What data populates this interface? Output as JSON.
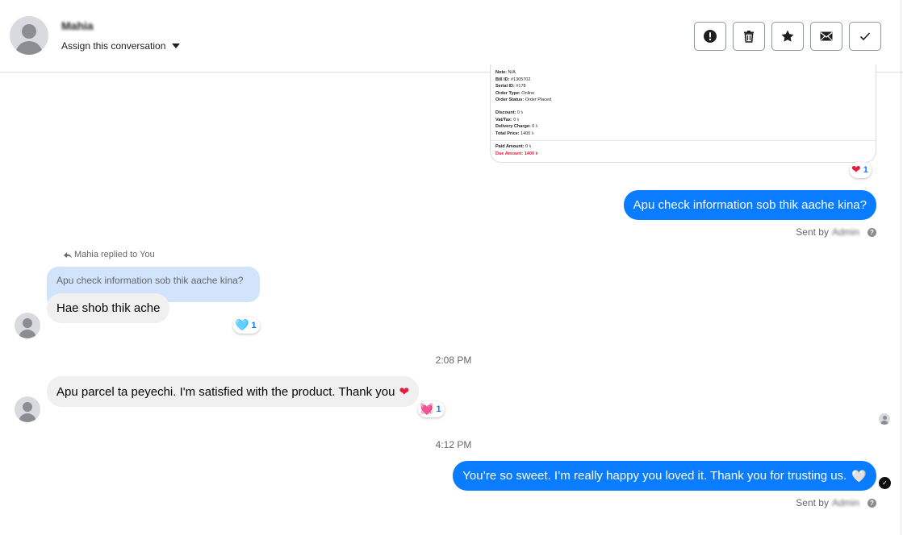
{
  "header": {
    "contact_name": "Mahia",
    "assign_label": "Assign this conversation",
    "actions": [
      {
        "name": "mark-spam",
        "icon": "exclamation-icon"
      },
      {
        "name": "delete",
        "icon": "trash-icon"
      },
      {
        "name": "star",
        "icon": "star-icon"
      },
      {
        "name": "mark-unread",
        "icon": "envelope-icon"
      },
      {
        "name": "mark-done",
        "icon": "check-icon"
      }
    ]
  },
  "receipt": {
    "note_label": "Note:",
    "note_value": "N/A",
    "bill_label": "Bill ID:",
    "bill_value": "#1305702",
    "serial_label": "Serial ID:",
    "serial_value": "#178",
    "order_type_label": "Order Type:",
    "order_type_value": "Online",
    "order_status_label": "Order Status:",
    "order_status_value": "Order Placed",
    "discount_label": "Discount:",
    "discount_value": "0 ৳",
    "vat_label": "Vat/Tax:",
    "vat_value": "0 ৳",
    "delivery_label": "Delivery Charge:",
    "delivery_value": "0 ৳",
    "total_label": "Total Price:",
    "total_value": "1400 ৳",
    "paid_label": "Paid Amount:",
    "paid_value": "0 ৳",
    "due_label": "Due Amount:",
    "due_value": "1400 ৳",
    "reaction": {
      "emoji": "❤",
      "count": "1"
    }
  },
  "messages": {
    "m1": {
      "text": "Apu check information sob thik aache kina?",
      "sent_by_label": "Sent by",
      "sent_by_name": "Admin"
    },
    "replied_to": "Mahia replied to You",
    "quote_text": "Apu check information sob thik aache kina?",
    "m2": {
      "text": "Hae shob thik ache",
      "reaction_emoji": "🩵",
      "reaction_count": "1"
    },
    "time1": "2:08 PM",
    "m3": {
      "text": "Apu parcel ta peyechi. I'm satisfied with the product. Thank you",
      "emoji": "❤",
      "reaction_emoji": "💓",
      "reaction_count": "1"
    },
    "time2": "4:12 PM",
    "m4": {
      "text": "You’re so sweet. I’m really happy you loved it. Thank you for trusting us.",
      "emoji": "🤍",
      "sent_by_label": "Sent by",
      "sent_by_name": "Admin"
    }
  },
  "colors": {
    "outgoing": "#0a7cff",
    "incoming": "#f0f0f0",
    "quote": "#d2e3fc"
  }
}
